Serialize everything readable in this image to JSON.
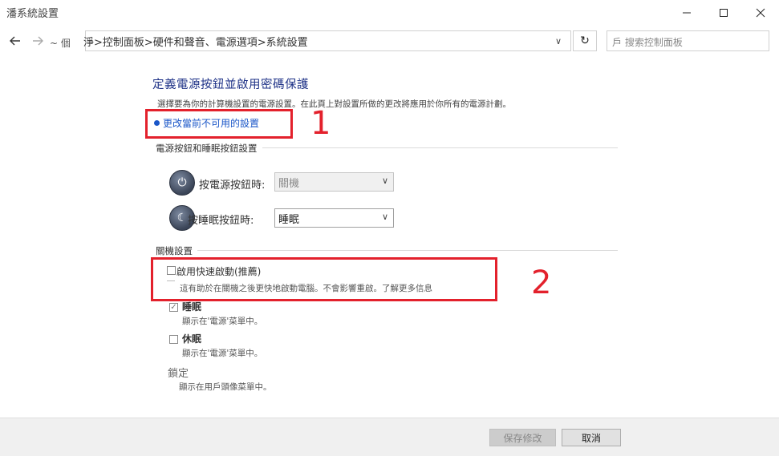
{
  "window": {
    "title": "潘系統設置",
    "controls": [
      "minimize-icon",
      "maximize-icon",
      "close-icon"
    ]
  },
  "nav": {
    "back_icon": "arrow-left-icon",
    "forward_icon": "arrow-right-icon",
    "prefix": "~ 個",
    "breadcrumb": "淨>控制面板>硬件和聲音、電源選項>系統設置",
    "refresh_icon": "refresh-icon",
    "search_placeholder": "戶 搜索控制面板"
  },
  "main": {
    "heading": "定義電源按鈕並啟用密碼保護",
    "description": "選擇要為你的計算機設置的電源設置。在此頁上對設置所做的更改將應用於你所有的電源計劃。",
    "change_link": "更改當前不可用的設置",
    "power_section": {
      "title": "電源按鈕和睡眠按鈕設置",
      "rows": [
        {
          "label": "按電源按鈕時:",
          "value": "關機",
          "disabled": true
        },
        {
          "label": "按睡眠按鈕時:",
          "value": "睡眠",
          "disabled": false
        }
      ]
    },
    "shutdown_section": {
      "title": "關機設置",
      "options": [
        {
          "title": "啟用快速啟動(推薦)",
          "desc": "這有助於在關機之後更快地啟動電腦。不會影響重啟。了解更多信息",
          "checked": false
        },
        {
          "title": "睡眠",
          "desc": "顯示在'電源'菜單中。",
          "checked": true
        },
        {
          "title": "休眠",
          "desc": "顯示在'電源'菜單中。",
          "checked": false
        },
        {
          "title": "鎖定",
          "desc": "顯示在用戶頭像菜單中。",
          "checked": false
        }
      ]
    }
  },
  "annotations": {
    "label1": "1",
    "label2": "2",
    "color": "#e3212c"
  },
  "footer": {
    "save_label": "保存修改",
    "cancel_label": "取消"
  }
}
